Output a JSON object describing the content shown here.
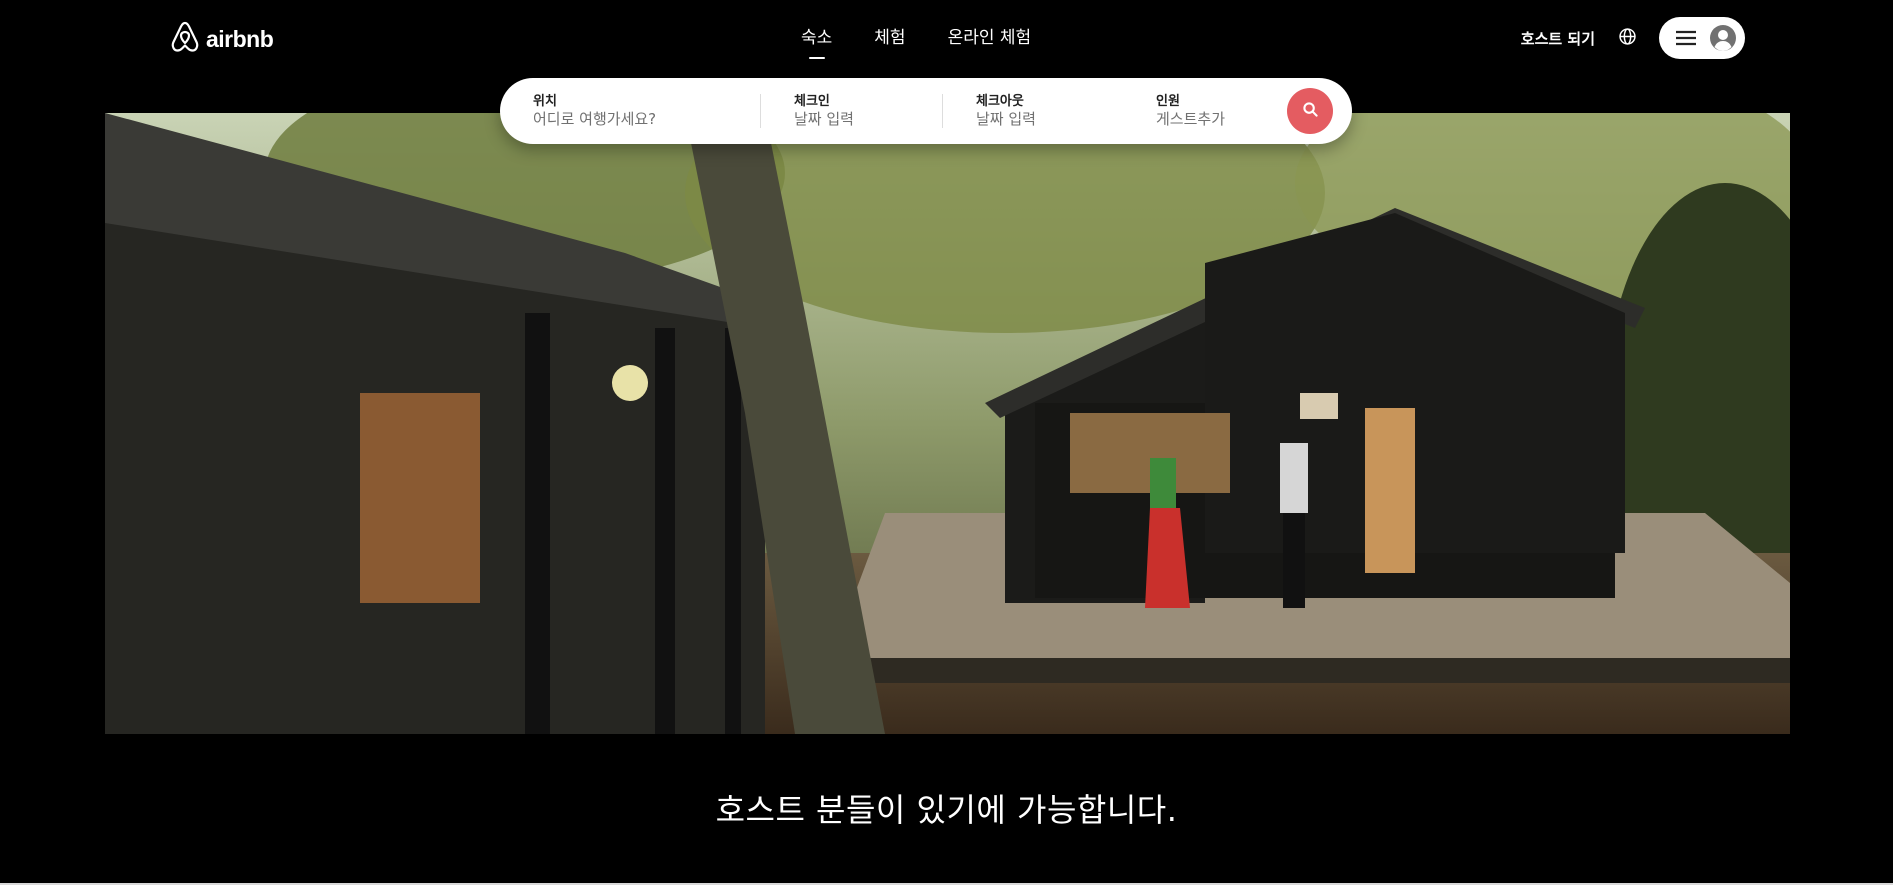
{
  "brand": {
    "name": "airbnb"
  },
  "nav": {
    "items": [
      {
        "label": "숙소",
        "active": true
      },
      {
        "label": "체험",
        "active": false
      },
      {
        "label": "온라인 체험",
        "active": false
      }
    ]
  },
  "header_actions": {
    "host_label": "호스트 되기",
    "globe_icon": "globe-icon",
    "menu_icon": "hamburger-menu-icon",
    "avatar_icon": "user-avatar-icon"
  },
  "search": {
    "location": {
      "label": "위치",
      "placeholder": "어디로 여행가세요?"
    },
    "checkin": {
      "label": "체크인",
      "placeholder": "날짜 입력"
    },
    "checkout": {
      "label": "체크아웃",
      "placeholder": "날짜 입력"
    },
    "guests": {
      "label": "인원",
      "placeholder": "게스트추가"
    },
    "button_icon": "search-icon",
    "accent_color": "#e45c61"
  },
  "hero": {
    "headline": "호스트 분들이 있기에 가능합니다."
  },
  "colors": {
    "background": "#000000",
    "text": "#ffffff",
    "accent": "#e45c61"
  }
}
